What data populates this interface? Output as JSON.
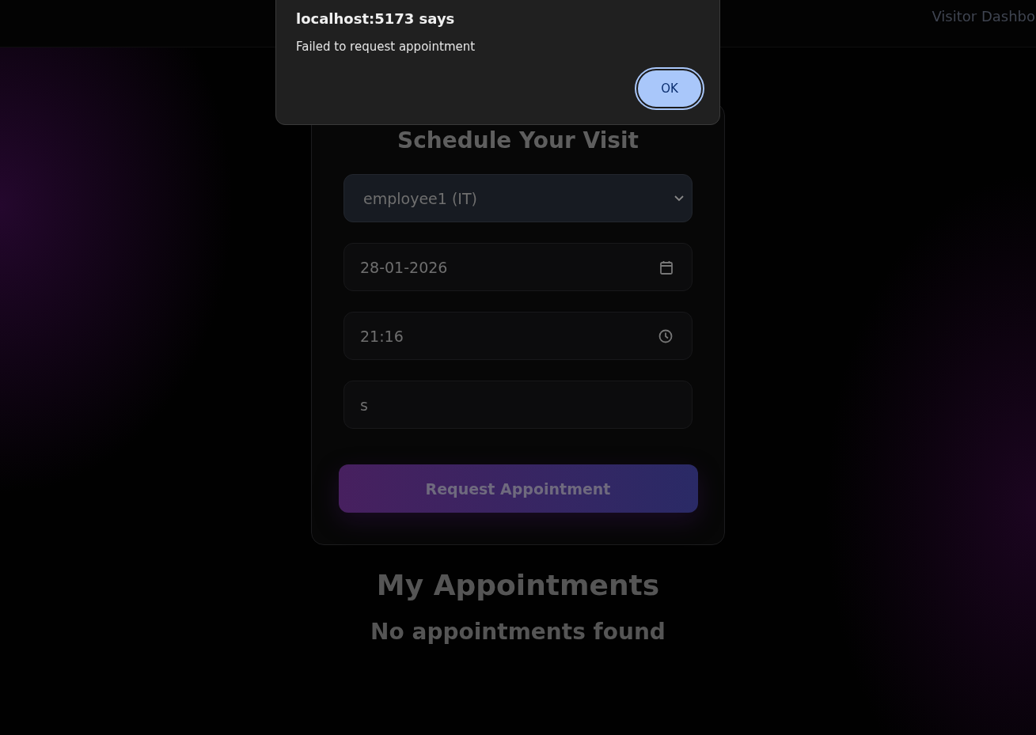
{
  "nav": {
    "title": "Visitor Dashbo"
  },
  "form": {
    "title": "Schedule Your Visit",
    "fields": [
      {
        "kind": "select",
        "value": "employee1 (IT)"
      },
      {
        "kind": "date",
        "value": "28-01-2026"
      },
      {
        "kind": "time",
        "value": "21:16"
      },
      {
        "kind": "text",
        "value": "s"
      }
    ],
    "submit": "Request Appointment"
  },
  "appointments": {
    "title": "My Appointments",
    "empty": "No appointments found"
  },
  "dialog": {
    "title": "localhost:5173 says",
    "message": "Failed to request appointment",
    "button": "OK"
  }
}
